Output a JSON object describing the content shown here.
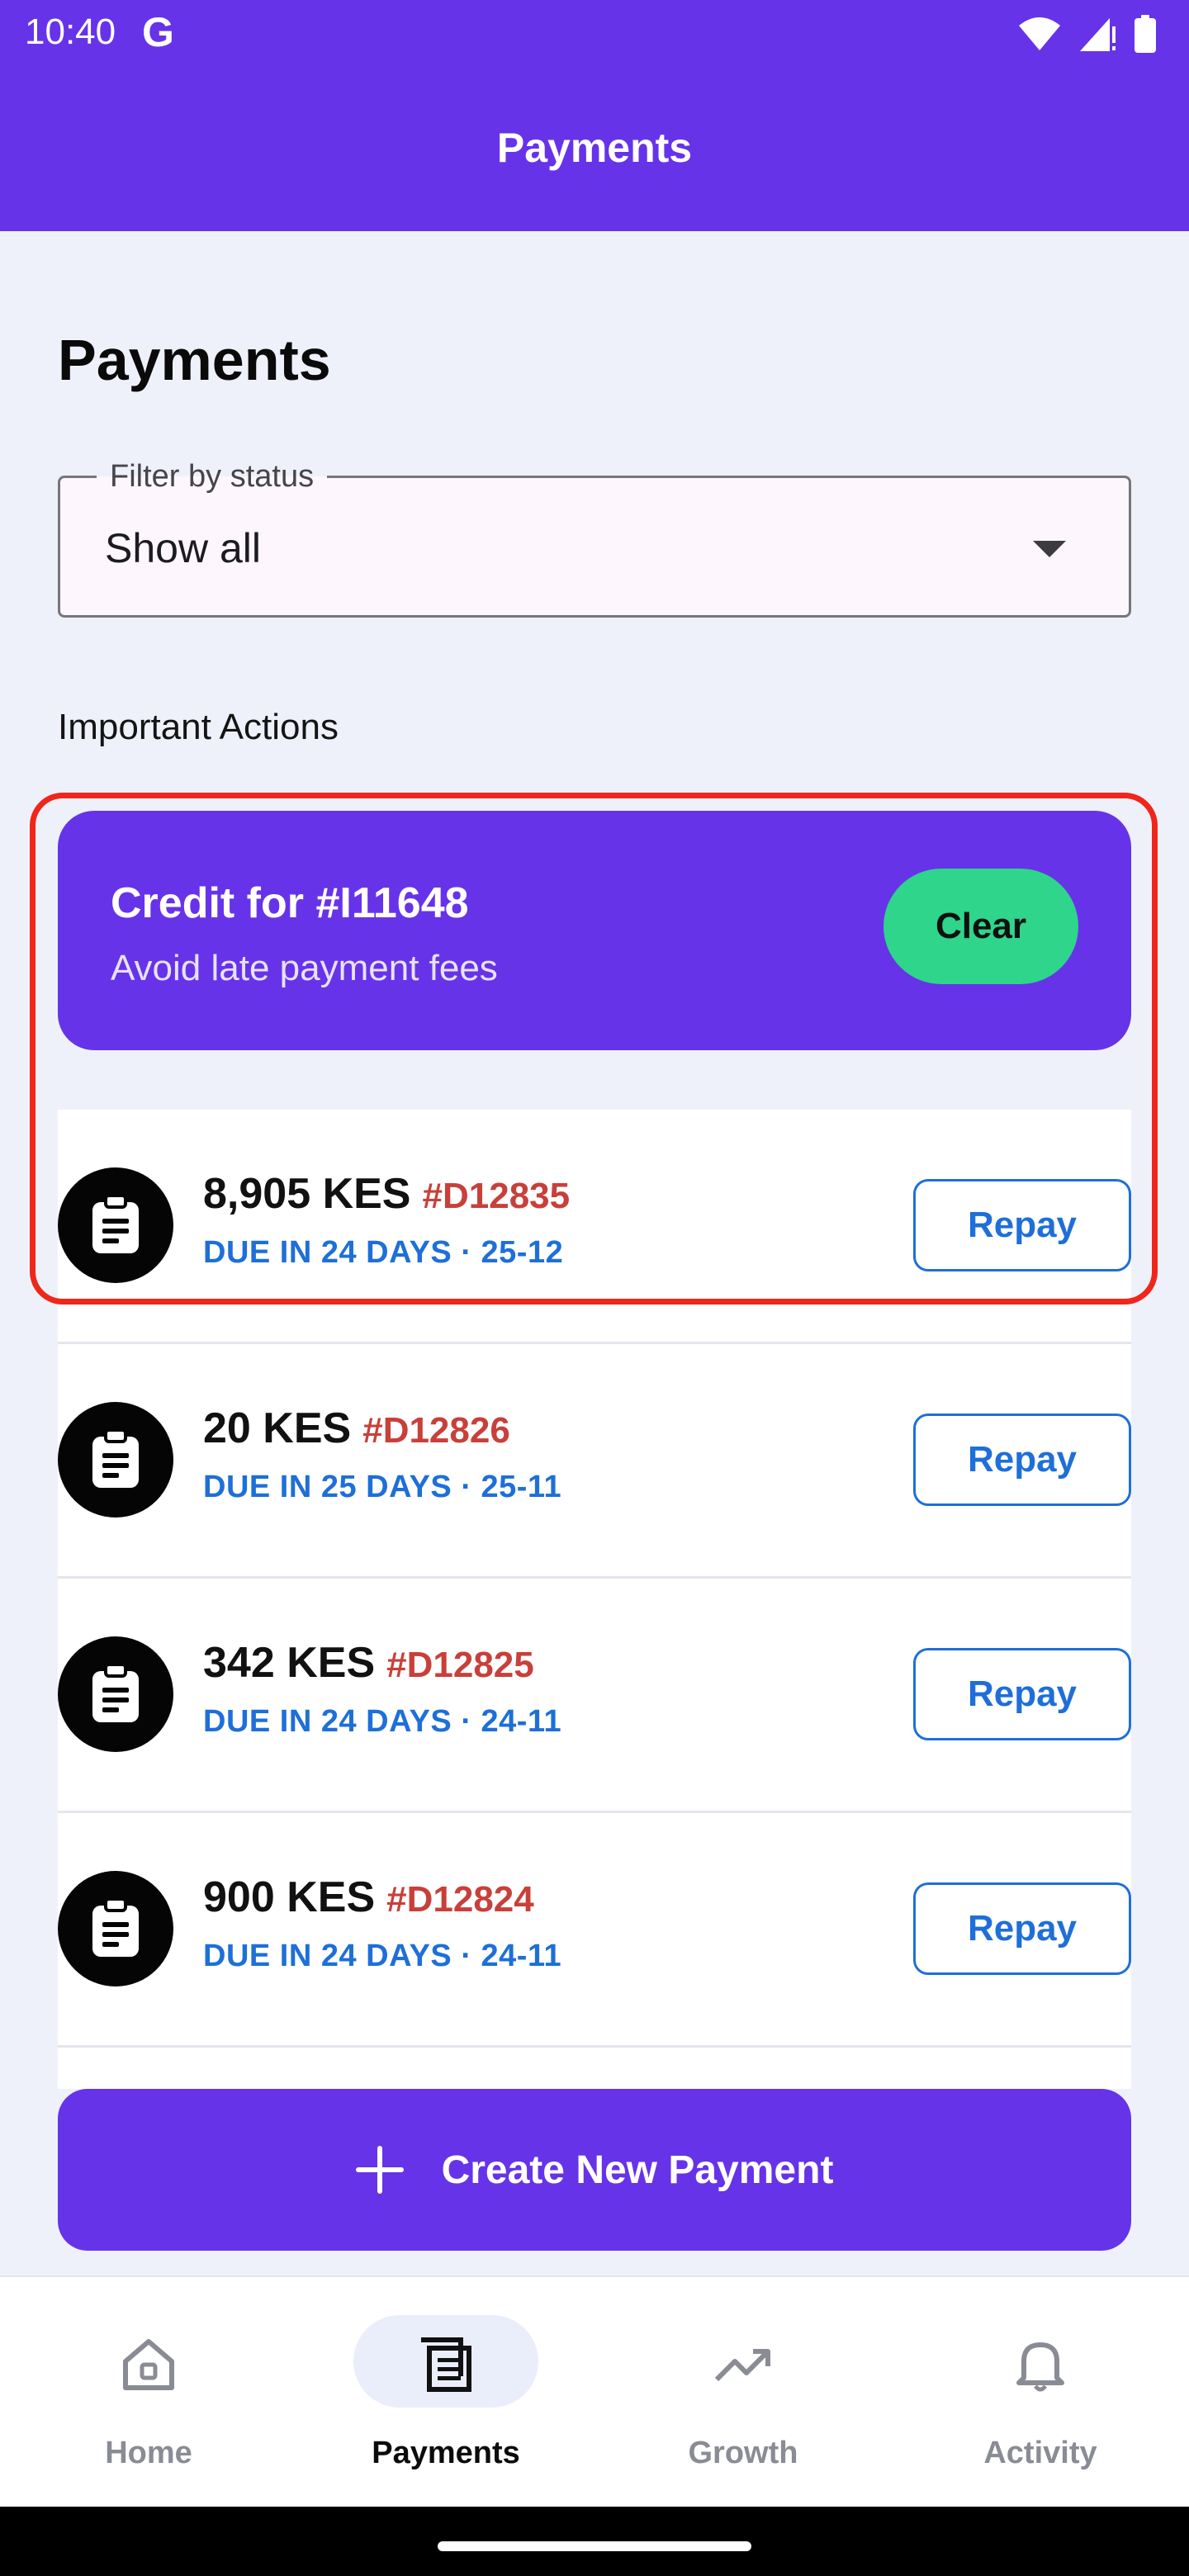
{
  "status_bar": {
    "time": "10:40",
    "google_glyph": "G",
    "icons": [
      "wifi-icon",
      "signal-icon",
      "battery-icon"
    ]
  },
  "app_bar": {
    "title": "Payments"
  },
  "page": {
    "title": "Payments"
  },
  "filter": {
    "label": "Filter by status",
    "value": "Show all"
  },
  "section": {
    "label": "Important Actions"
  },
  "credit": {
    "title": "Credit for #I11648",
    "subtitle": "Avoid late payment fees",
    "button": "Clear"
  },
  "payments": [
    {
      "amount": "8,905 KES",
      "id": "#D12835",
      "due": "DUE IN 24 DAYS · 25-12",
      "button": "Repay"
    },
    {
      "amount": "20 KES",
      "id": "#D12826",
      "due": "DUE IN 25 DAYS · 25-11",
      "button": "Repay"
    },
    {
      "amount": "342 KES",
      "id": "#D12825",
      "due": "DUE IN 24 DAYS · 24-11",
      "button": "Repay"
    },
    {
      "amount": "900 KES",
      "id": "#D12824",
      "due": "DUE IN 24 DAYS · 24-11",
      "button": "Repay"
    }
  ],
  "create_button": {
    "label": "Create New Payment"
  },
  "nav": [
    {
      "label": "Home",
      "icon": "home-icon",
      "active": false
    },
    {
      "label": "Payments",
      "icon": "receipt-icon",
      "active": true
    },
    {
      "label": "Growth",
      "icon": "trending-up-icon",
      "active": false
    },
    {
      "label": "Activity",
      "icon": "bell-icon",
      "active": false
    }
  ],
  "colors": {
    "brand": "#6633E9",
    "accent_green": "#2ED58A",
    "link_blue": "#1E6FD8",
    "id_red": "#C8403A",
    "highlight_red": "#F0261A"
  }
}
